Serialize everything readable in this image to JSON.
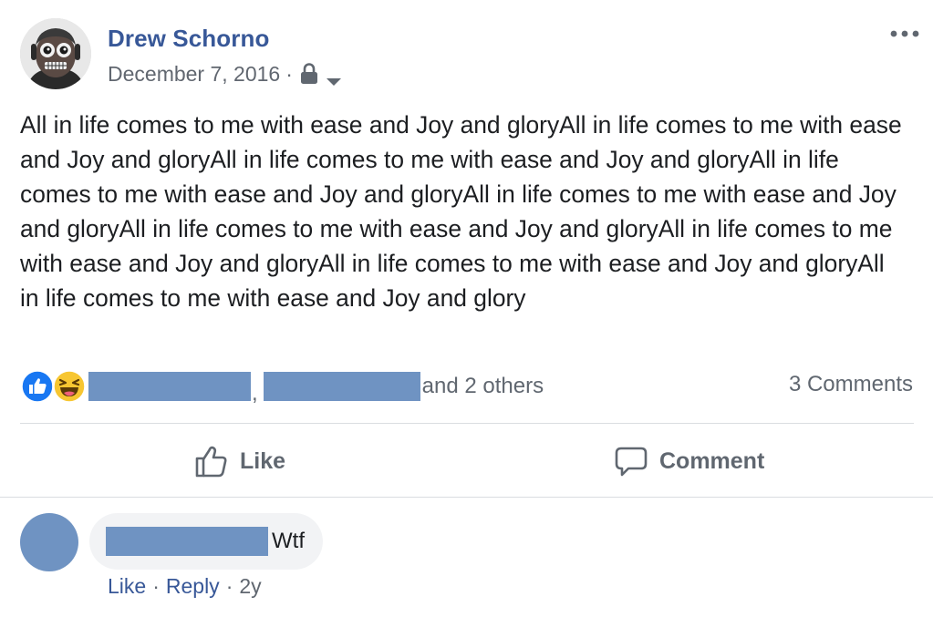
{
  "post": {
    "author": "Drew Schorno",
    "date": "December 7, 2016",
    "separator": "·",
    "text": "All in life comes to me with ease and Joy and gloryAll in life comes to me with ease and Joy and gloryAll in life comes to me with ease and Joy and gloryAll in life comes to me with ease and Joy and gloryAll in life comes to me with ease and Joy and gloryAll in life comes to me with ease and Joy and gloryAll in life comes to me with ease and Joy and gloryAll in life comes to me with ease and Joy and gloryAll in life comes to me with ease and Joy and glory",
    "audience_icon": "lock-icon",
    "menu_icon": "more-horizontal-icon"
  },
  "reactions": {
    "icons": [
      "like-reaction-icon",
      "haha-reaction-icon"
    ],
    "comma": ",",
    "others_text": "and 2 others",
    "comments_count": "3 Comments"
  },
  "actions": {
    "like_label": "Like",
    "comment_label": "Comment"
  },
  "comment": {
    "text": "Wtf",
    "like_label": "Like",
    "reply_label": "Reply",
    "time": "2y",
    "separator": "·"
  },
  "colors": {
    "link_blue": "#385898",
    "redaction_blue": "#6f93c2",
    "secondary_text": "#606770",
    "like_blue": "#1877f2",
    "haha_yellow": "#f7c631"
  }
}
